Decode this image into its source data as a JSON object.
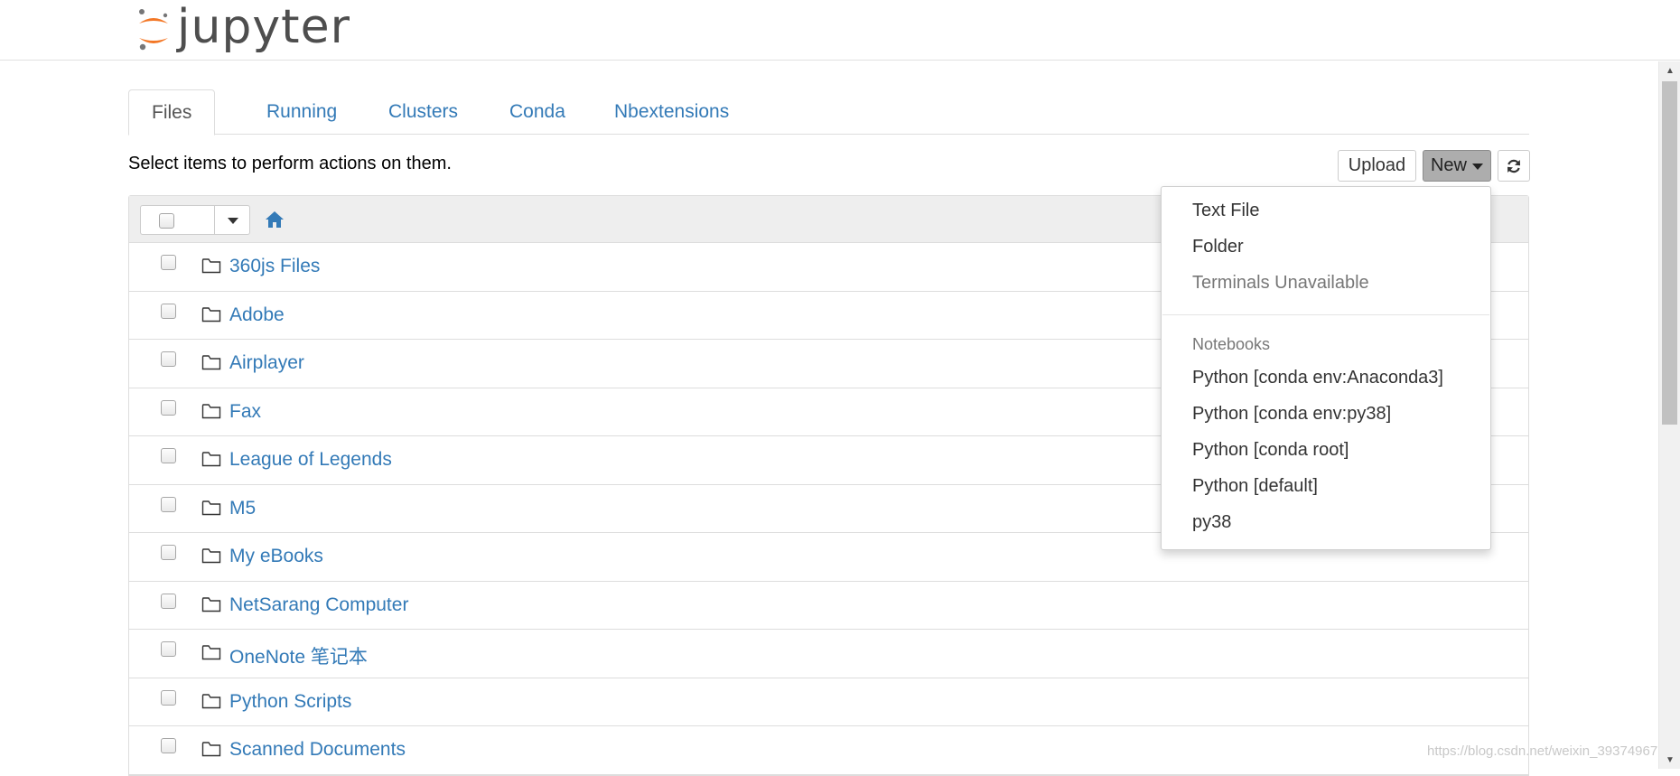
{
  "header": {
    "logo_text": "jupyter",
    "brand_color": "#f37726"
  },
  "tabs": [
    {
      "label": "Files",
      "active": true
    },
    {
      "label": "Running",
      "active": false
    },
    {
      "label": "Clusters",
      "active": false
    },
    {
      "label": "Conda",
      "active": false
    },
    {
      "label": "Nbextensions",
      "active": false
    }
  ],
  "toolbar": {
    "hint": "Select items to perform actions on them.",
    "upload_label": "Upload",
    "new_label": "New",
    "refresh_icon": "refresh-icon"
  },
  "list": {
    "home_icon": "home-icon",
    "items": [
      {
        "name": "360js Files",
        "type": "folder"
      },
      {
        "name": "Adobe",
        "type": "folder"
      },
      {
        "name": "Airplayer",
        "type": "folder"
      },
      {
        "name": "Fax",
        "type": "folder"
      },
      {
        "name": "League of Legends",
        "type": "folder"
      },
      {
        "name": "M5",
        "type": "folder"
      },
      {
        "name": "My eBooks",
        "type": "folder"
      },
      {
        "name": "NetSarang Computer",
        "type": "folder"
      },
      {
        "name": "OneNote 笔记本",
        "type": "folder"
      },
      {
        "name": "Python Scripts",
        "type": "folder"
      },
      {
        "name": "Scanned Documents",
        "type": "folder"
      }
    ]
  },
  "new_menu": {
    "items": [
      "Text File",
      "Folder"
    ],
    "disabled_item": "Terminals Unavailable",
    "notebooks_header": "Notebooks",
    "notebooks": [
      "Python [conda env:Anaconda3]",
      "Python [conda env:py38]",
      "Python [conda root]",
      "Python [default]",
      "py38"
    ]
  },
  "watermark": "https://blog.csdn.net/weixin_39374967",
  "colors": {
    "link": "#337ab7",
    "active_button": "#adadad"
  }
}
